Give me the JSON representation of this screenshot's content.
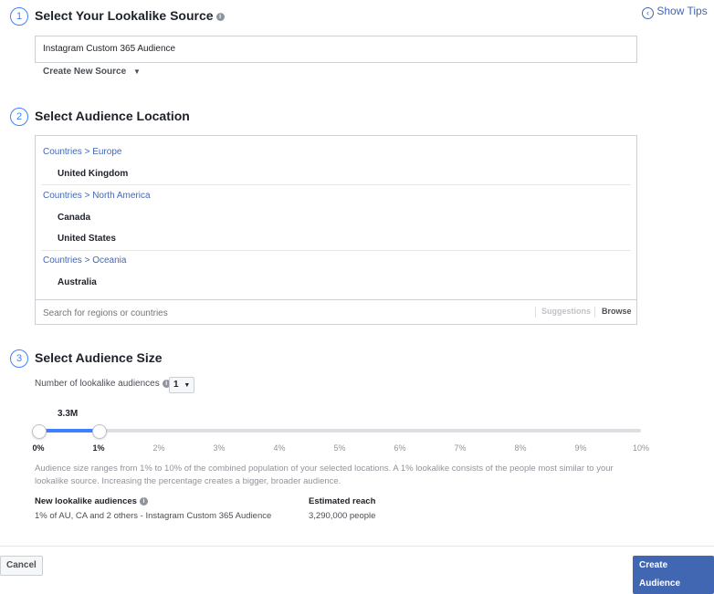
{
  "header": {
    "show_tips": "Show Tips"
  },
  "steps": [
    {
      "number": "1",
      "title": "Select Your Lookalike Source"
    },
    {
      "number": "2",
      "title": "Select Audience Location"
    },
    {
      "number": "3",
      "title": "Select Audience Size"
    }
  ],
  "source": {
    "selected": "Instagram Custom 365 Audience",
    "create_new": "Create New Source"
  },
  "location": {
    "groups": [
      {
        "path": "Countries > Europe",
        "items": [
          "United Kingdom"
        ]
      },
      {
        "path": "Countries > North America",
        "items": [
          "Canada",
          "United States"
        ]
      },
      {
        "path": "Countries > Oceania",
        "items": [
          "Australia"
        ]
      }
    ],
    "search_placeholder": "Search for regions or countries",
    "suggestions": "Suggestions",
    "browse": "Browse"
  },
  "size": {
    "count_label": "Number of lookalike audiences",
    "count_value": "1",
    "slider_value_label": "3.3M",
    "slider_range_percent": [
      0,
      1
    ],
    "ticks": [
      "0%",
      "1%",
      "2%",
      "3%",
      "4%",
      "5%",
      "6%",
      "7%",
      "8%",
      "9%",
      "10%"
    ],
    "description": "Audience size ranges from 1% to 10% of the combined population of your selected locations. A 1% lookalike consists of the people most similar to your lookalike source. Increasing the percentage creates a bigger, broader audience.",
    "new_audiences_header": "New lookalike audiences",
    "estimated_reach_header": "Estimated reach",
    "audience_name": "1% of AU, CA and 2 others - Instagram Custom 365 Audience",
    "audience_reach": "3,290,000 people"
  },
  "footer": {
    "cancel": "Cancel",
    "create": "Create Audience"
  },
  "colors": {
    "accent": "#4080ff",
    "link": "#4267b2",
    "primary_button": "#4267b2"
  }
}
